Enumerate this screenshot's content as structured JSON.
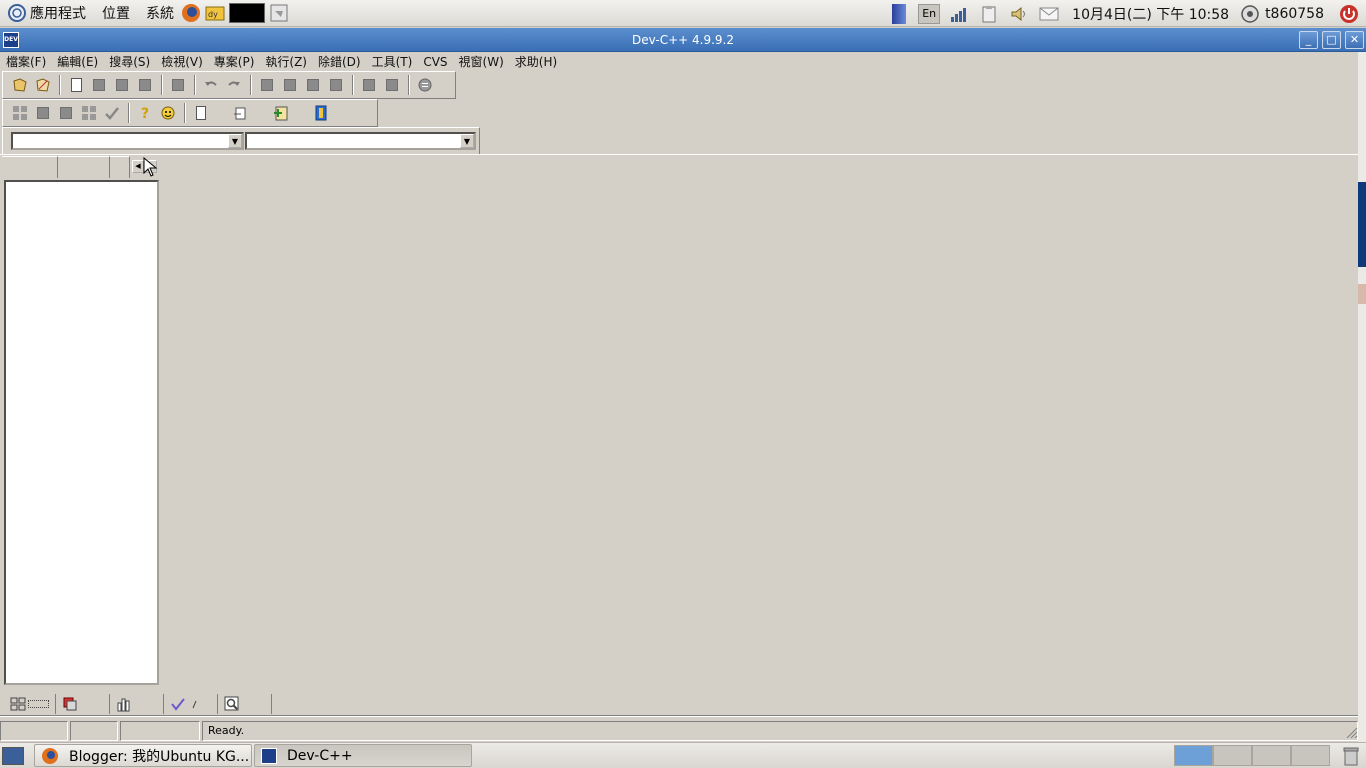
{
  "top_panel": {
    "menus": [
      "應用程式",
      "位置",
      "系統"
    ],
    "clock": "10月4日(二) 下午 10:58",
    "user": "t860758",
    "input_method": "En"
  },
  "window": {
    "title": "Dev-C++ 4.9.9.2",
    "menu": [
      "檔案(F)",
      "編輯(E)",
      "搜尋(S)",
      "檢視(V)",
      "專案(P)",
      "執行(Z)",
      "除錯(D)",
      "工具(T)",
      "CVS",
      "視窗(W)",
      "求助(H)"
    ]
  },
  "status": {
    "message": "Ready."
  },
  "taskbar": {
    "items": [
      "Blogger: 我的Ubuntu KG...",
      "Dev-C++"
    ]
  },
  "colors": {
    "titlebar": "#3a6fb5",
    "face": "#d4d0c8"
  }
}
